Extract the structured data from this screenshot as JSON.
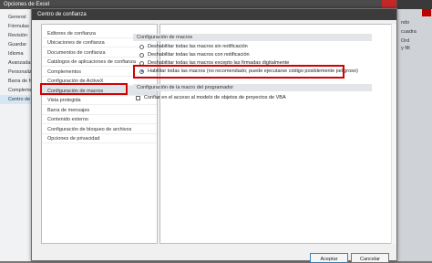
{
  "outer": {
    "title": "Opciones de Excel",
    "nav": [
      {
        "label": "General"
      },
      {
        "label": "Fórmulas"
      },
      {
        "label": "Revisión"
      },
      {
        "label": "Guardar"
      },
      {
        "label": "Idioma"
      },
      {
        "label": "Avanzadas"
      },
      {
        "label": "Personalizar"
      },
      {
        "label": "Barra de herr"
      },
      {
        "label": "Complementos"
      },
      {
        "label": "Centro de con"
      }
    ]
  },
  "background_right": {
    "labels": [
      "ndo",
      "cuadra",
      "Ord",
      "y filt"
    ]
  },
  "dialog": {
    "title": "Centro de confianza",
    "sidebar": [
      {
        "label": "Editores de confianza"
      },
      {
        "label": "Ubicaciones de confianza"
      },
      {
        "label": "Documentos de confianza"
      },
      {
        "label": "Catálogos de aplicaciones de confianza"
      },
      {
        "label": "Complementos"
      },
      {
        "label": "Configuración de ActiveX"
      },
      {
        "label": "Configuración de macros"
      },
      {
        "label": "Vista protegida"
      },
      {
        "label": "Barra de mensajes"
      },
      {
        "label": "Contenido externo"
      },
      {
        "label": "Configuración de bloqueo de archivos"
      },
      {
        "label": "Opciones de privacidad"
      }
    ],
    "macro_section_title": "Configuración de macros",
    "macro_options": [
      {
        "label": "Deshabilitar todas las macros sin notificación",
        "selected": false
      },
      {
        "label": "Deshabilitar todas las macros con notificación",
        "selected": false
      },
      {
        "label": "Deshabilitar todas las macros excepto las firmadas digitalmente",
        "selected": false
      },
      {
        "label": "Habilitar todas las macros (no recomendado; puede ejecutarse código posiblemente peligroso)",
        "selected": true
      }
    ],
    "developer_section_title": "Configuración de la macro del programador",
    "vba_checkbox": {
      "label": "Confiar en el acceso al modelo de objetos de proyectos de VBA",
      "checked": false
    },
    "ok_label": "Aceptar",
    "cancel_label": "Cancelar"
  },
  "colors": {
    "highlight": "#d40000",
    "selection": "#dfe4ea",
    "title_bar": "#3b3b3b"
  }
}
